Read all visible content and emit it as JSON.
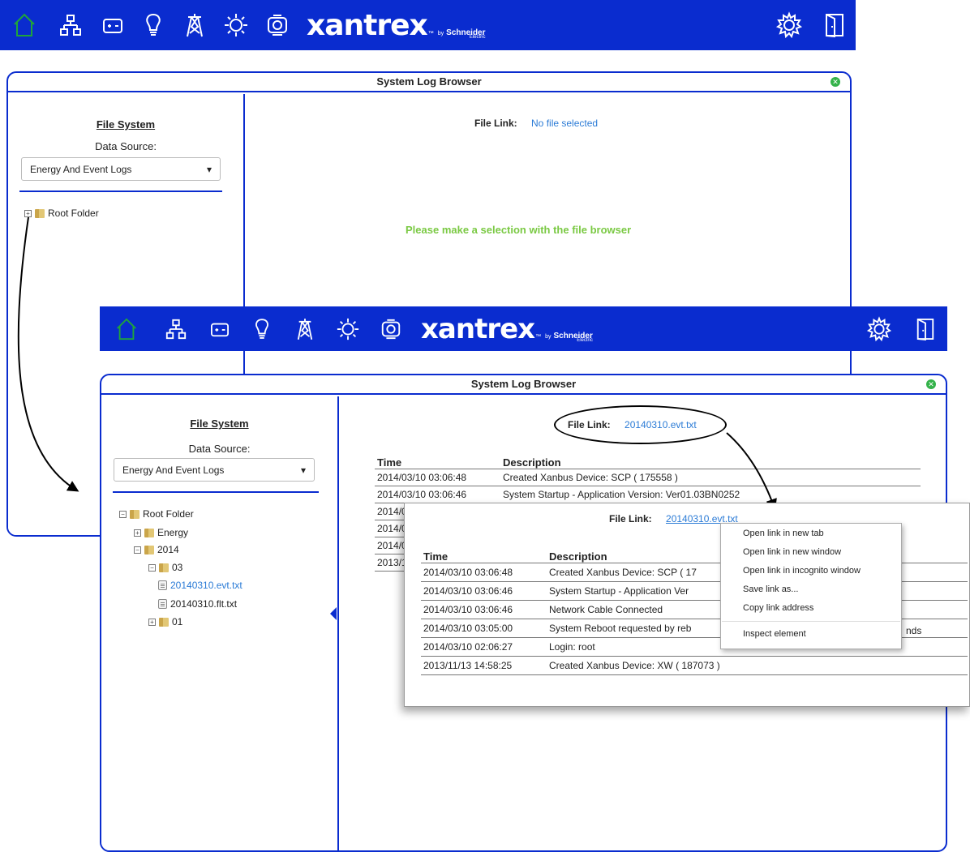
{
  "brand": {
    "name": "xantrex",
    "tm": "™",
    "by": "by",
    "company": "Schneider",
    "company_sub": "Electric"
  },
  "nav_icons": [
    "home-icon",
    "network-icon",
    "battery-icon",
    "lightbulb-icon",
    "tower-icon",
    "sun-icon",
    "generator-icon"
  ],
  "right_icons": [
    "gear-icon",
    "logout-icon"
  ],
  "panel_title": "System Log Browser",
  "sidebar": {
    "file_system_title": "File System",
    "data_source_label": "Data Source:",
    "data_source_value": "Energy And Event Logs",
    "dropdown_arrow": "▾"
  },
  "tree_back": {
    "root": "Root Folder"
  },
  "tree_front": {
    "root": "Root Folder",
    "energy": "Energy",
    "year": "2014",
    "month": "03",
    "file_evt": "20140310.evt.txt",
    "file_flt": "20140310.flt.txt",
    "month2": "01"
  },
  "back_main": {
    "file_link_label": "File Link:",
    "file_link_value": "No file selected",
    "prompt": "Please make a selection with the file browser"
  },
  "front_main": {
    "file_link_label": "File Link:",
    "file_link_value": "20140310.evt.txt",
    "col_time": "Time",
    "col_desc": "Description",
    "rows": [
      {
        "time": "2014/03/10 03:06:48",
        "desc": "Created Xanbus Device: SCP ( 175558 )"
      },
      {
        "time": "2014/03/10 03:06:46",
        "desc": "System Startup - Application Version: Ver01.03BN0252"
      },
      {
        "time": "2014/03/10 03:06:46",
        "desc": ""
      },
      {
        "time": "2014/03/10 03:05:00",
        "desc": ""
      },
      {
        "time": "2014/03/10 02:06:27",
        "desc": ""
      },
      {
        "time": "2013/11/13 14:58:25",
        "desc": ""
      }
    ]
  },
  "popup": {
    "file_link_label": "File Link:",
    "file_link_value": "20140310.evt.txt",
    "col_time": "Time",
    "col_desc": "Description",
    "rows": [
      {
        "time": "2014/03/10 03:06:48",
        "desc": "Created Xanbus Device: SCP ( 17"
      },
      {
        "time": "2014/03/10 03:06:46",
        "desc": "System Startup - Application Ver"
      },
      {
        "time": "2014/03/10 03:06:46",
        "desc": "Network Cable Connected"
      },
      {
        "time": "2014/03/10 03:05:00",
        "desc": "System Reboot requested by reb"
      },
      {
        "time": "2014/03/10 02:06:27",
        "desc": "Login: root"
      },
      {
        "time": "2013/11/13 14:58:25",
        "desc": "Created Xanbus Device: XW ( 187073 )"
      }
    ],
    "overflow_text": "nds"
  },
  "context_menu": {
    "items": [
      "Open link in new tab",
      "Open link in new window",
      "Open link in incognito window",
      "Save link as...",
      "Copy link address"
    ],
    "inspect": "Inspect element"
  },
  "colors": {
    "nav_blue": "#0a2ccf",
    "home_green": "#1fa53a",
    "link_blue": "#2b7bd6",
    "prompt_green": "#7ac943"
  }
}
